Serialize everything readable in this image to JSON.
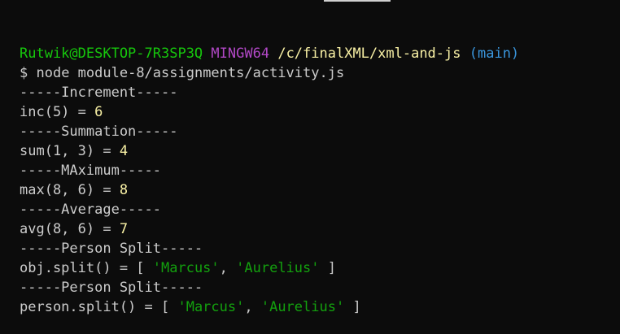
{
  "prompt": {
    "user_host": "Rutwik@DESKTOP-7R3SP3Q",
    "system": "MINGW64",
    "path": "/c/finalXML/xml-and-js",
    "branch": "(main)"
  },
  "command": {
    "symbol": "$",
    "text": "node module-8/assignments/activity.js"
  },
  "output": {
    "increment_header": "-----Increment-----",
    "inc_expr": "inc(5) = ",
    "inc_result": "6",
    "summation_header": "-----Summation-----",
    "sum_expr": "sum(1, 3) = ",
    "sum_result": "4",
    "maximum_header": "-----MAximum-----",
    "max_expr": "max(8, 6) = ",
    "max_result": "8",
    "average_header": "-----Average-----",
    "avg_expr": "avg(8, 6) = ",
    "avg_result": "7",
    "person_split_header_1": "-----Person Split-----",
    "obj_split_expr": "obj.split() = [ ",
    "obj_split_first": "'Marcus'",
    "obj_split_sep": ", ",
    "obj_split_second": "'Aurelius'",
    "obj_split_close": " ]",
    "person_split_header_2": "-----Person Split-----",
    "person_split_expr": "person.split() = [ ",
    "person_split_first": "'Marcus'",
    "person_split_sep": ", ",
    "person_split_second": "'Aurelius'",
    "person_split_close": " ]"
  },
  "colors": {
    "background": "#0c0c0c",
    "text": "#cccccc",
    "user_host": "#16c60c",
    "system": "#b148c6",
    "path": "#f9f1a5",
    "branch": "#3a96dd",
    "number": "#f9f1a5",
    "string": "#13a10e"
  }
}
